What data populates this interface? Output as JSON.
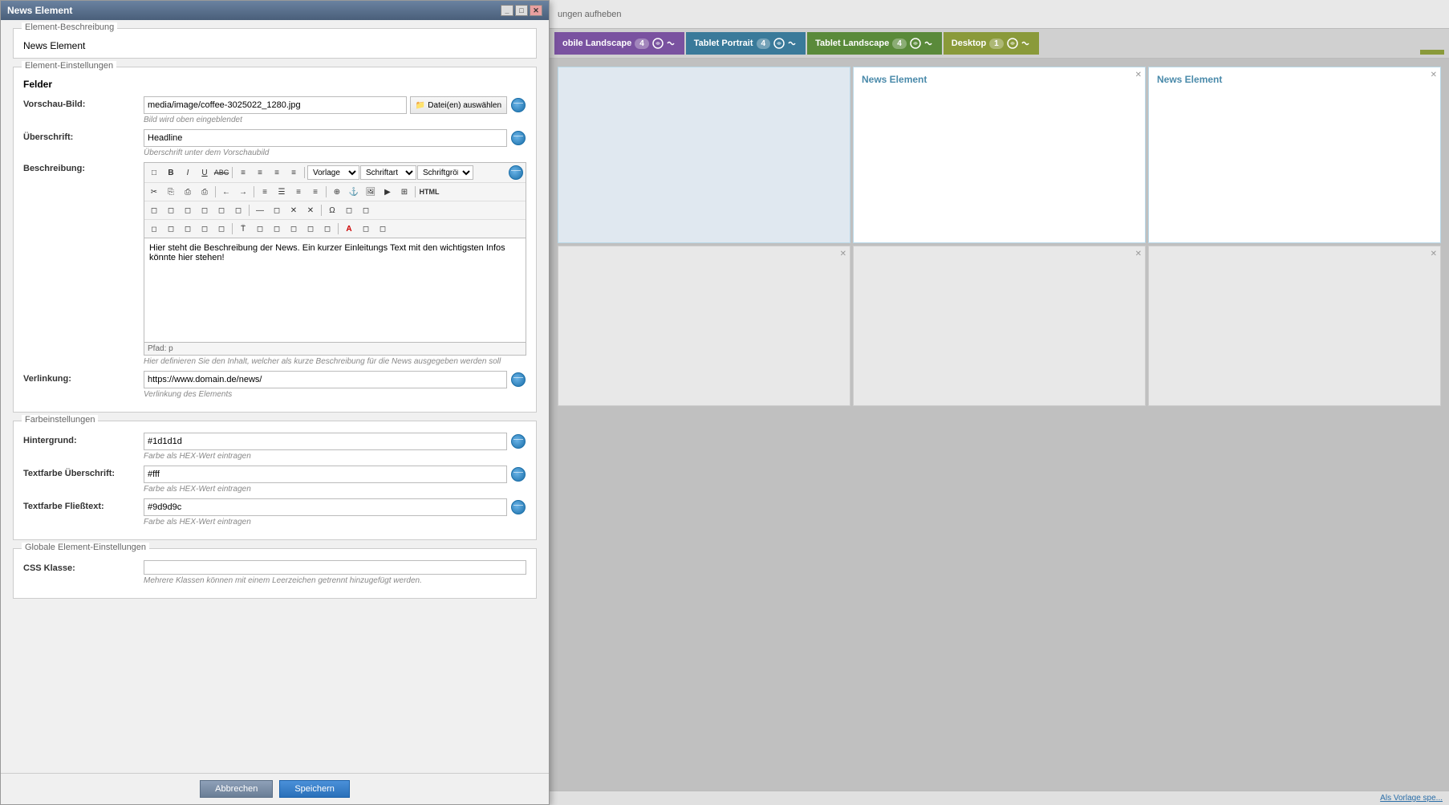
{
  "dialog": {
    "title": "News Element",
    "titlebar_buttons": [
      "minimize",
      "maximize",
      "close"
    ],
    "sections": {
      "element_description": {
        "label": "Element-Beschreibung",
        "value": "News Element"
      },
      "element_settings": {
        "label": "Element-Einstellungen",
        "fields_label": "Felder",
        "preview_image": {
          "label": "Vorschau-Bild:",
          "value": "media/image/coffee-3025022_1280.jpg",
          "button": "Datei(en) auswählen",
          "hint": "Bild wird oben eingeblendet"
        },
        "headline": {
          "label": "Überschrift:",
          "value": "Headline",
          "hint": "Überschrift unter dem Vorschaubild"
        },
        "description": {
          "label": "Beschreibung:",
          "content": "Hier steht die Beschreibung der News. Ein kurzer Einleitungs Text mit den wichtigsten Infos könnte hier stehen!",
          "path": "Pfad: p",
          "hint": "Hier definieren Sie den Inhalt, welcher als kurze Beschreibung für die News ausgegeben werden soll",
          "toolbar": {
            "row1_buttons": [
              "□",
              "B",
              "I",
              "U",
              "ABC",
              "≡",
              "≡",
              "≡",
              "≡"
            ],
            "row1_selects": [
              "Vorlage",
              "Schriftart",
              "Schriftgröße"
            ],
            "row2_buttons": [
              "✂",
              "⎘",
              "⎙",
              "⎙",
              "←",
              "→",
              "≡",
              "☰",
              "≡",
              "≡",
              "⊕",
              "⊕",
              "⊕",
              "⊕",
              "⊕",
              "HTML"
            ],
            "row3_buttons": [
              "◻",
              "◻",
              "◻",
              "◻",
              "◻",
              "◻",
              "◻",
              "—",
              "◻",
              "✕",
              "✕",
              "Ω",
              "◻",
              "◻"
            ],
            "row4_buttons": [
              "◻",
              "◻",
              "◻",
              "◻",
              "◻",
              "T",
              "◻",
              "◻",
              "◻",
              "◻",
              "◻",
              "◻",
              "A",
              "◻",
              "◻"
            ]
          }
        },
        "verlinkung": {
          "label": "Verlinkung:",
          "value": "https://www.domain.de/news/",
          "hint": "Verlinkung des Elements"
        }
      },
      "color_settings": {
        "label": "Farbeinstellungen",
        "hintergrund": {
          "label": "Hintergrund:",
          "value": "#1d1d1d",
          "hint": "Farbe als HEX-Wert eintragen"
        },
        "text_headline": {
          "label": "Textfarbe Überschrift:",
          "value": "#fff",
          "hint": "Farbe als HEX-Wert eintragen"
        },
        "text_body": {
          "label": "Textfarbe Fließtext:",
          "value": "#9d9d9c",
          "hint": "Farbe als HEX-Wert eintragen"
        }
      },
      "global_settings": {
        "label": "Globale Element-Einstellungen",
        "css_class": {
          "label": "CSS Klasse:",
          "value": "",
          "hint": "Mehrere Klassen können mit einem Leerzeichen getrennt hinzugefügt werden."
        }
      }
    },
    "footer": {
      "cancel": "Abbrechen",
      "save": "Speichern"
    }
  },
  "canvas": {
    "topbar_text": "ungen aufheben",
    "tabs": [
      {
        "label": "obile Landscape",
        "count": "4",
        "color": "#7a52a0"
      },
      {
        "label": "Tablet Portrait",
        "count": "4",
        "color": "#3a7a9a"
      },
      {
        "label": "Tablet Landscape",
        "count": "4",
        "color": "#5a8a3a"
      },
      {
        "label": "Desktop",
        "count": "1",
        "color": "#8a9a3a"
      }
    ],
    "cards_top": [
      {
        "title": ""
      },
      {
        "title": "News Element"
      },
      {
        "title": "News Element"
      }
    ],
    "bottom_bar": "Als Vorlage spe..."
  }
}
